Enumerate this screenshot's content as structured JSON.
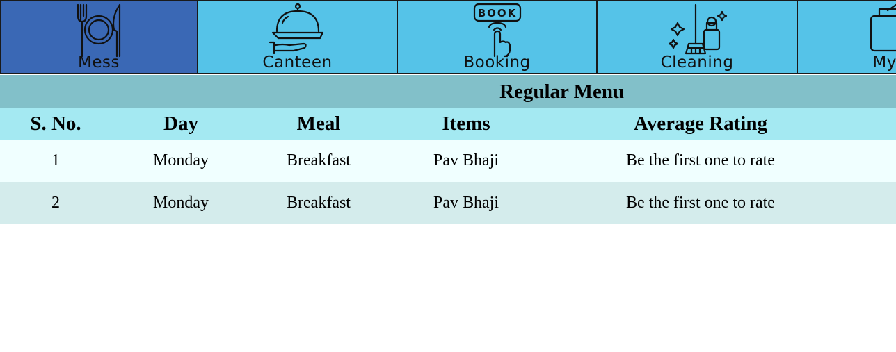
{
  "nav": {
    "tabs": [
      {
        "label": "Mess",
        "icon": "plate-cutlery-icon",
        "active": true
      },
      {
        "label": "Canteen",
        "icon": "food-cloche-icon",
        "active": false
      },
      {
        "label": "Booking",
        "icon": "book-tap-icon",
        "active": false
      },
      {
        "label": "Cleaning",
        "icon": "cleaning-tools-icon",
        "active": false
      },
      {
        "label": "My Ac",
        "icon": "account-icon",
        "active": false
      }
    ]
  },
  "colors": {
    "tab_active": "#3a68b5",
    "tab_bg": "#55c3e8",
    "section_title_bg": "#82c0c9",
    "table_header_bg": "#a4e9f2",
    "row_odd_bg": "#f0ffff",
    "row_even_bg": "#d4ecec"
  },
  "section": {
    "title": "Regular Menu"
  },
  "table": {
    "headers": [
      "S. No.",
      "Day",
      "Meal",
      "Items",
      "Average Rating"
    ],
    "rows": [
      [
        "1",
        "Monday",
        "Breakfast",
        "Pav Bhaji",
        "Be the first one to rate"
      ],
      [
        "2",
        "Monday",
        "Breakfast",
        "Pav Bhaji",
        "Be the first one to rate"
      ]
    ]
  }
}
